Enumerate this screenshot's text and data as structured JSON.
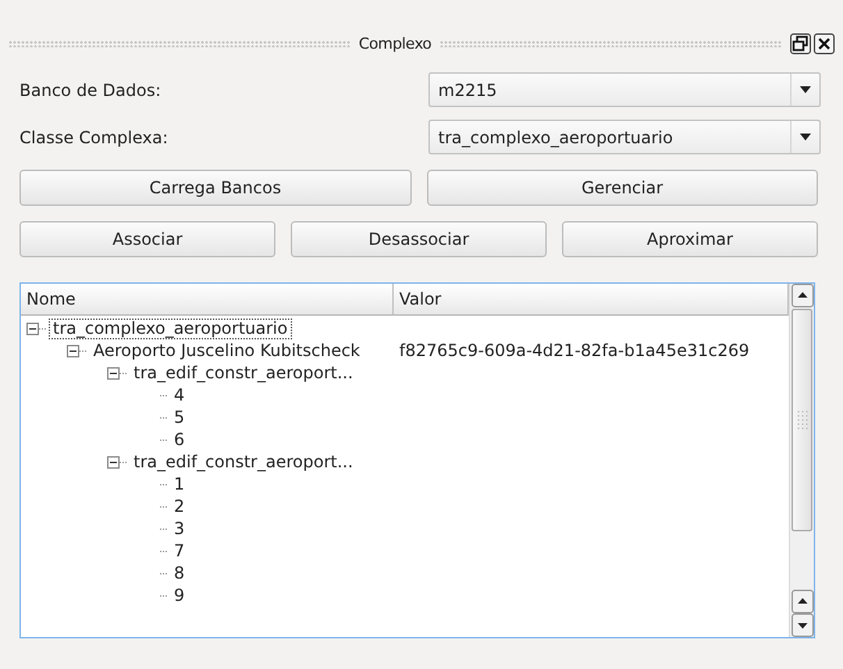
{
  "window": {
    "title": "Complexo"
  },
  "fields": [
    {
      "label": "Banco de Dados:",
      "value": "m2215"
    },
    {
      "label": "Classe Complexa:",
      "value": "tra_complexo_aeroportuario"
    }
  ],
  "button_rows": [
    [
      "Carrega Bancos",
      "Gerenciar"
    ],
    [
      "Associar",
      "Desassociar",
      "Aproximar"
    ]
  ],
  "tree": {
    "columns": [
      "Nome",
      "Valor"
    ],
    "rows": [
      {
        "name": "tra_complexo_aeroportuario",
        "selected": true,
        "expanded": true,
        "children": [
          {
            "name": "Aeroporto Juscelino Kubitscheck",
            "value": "f82765c9-609a-4d21-82fa-b1a45e31c269",
            "selected": false,
            "expanded": true,
            "children": [
              {
                "name": "tra_edif_constr_aeroport...",
                "selected": false,
                "expanded": true,
                "children": [
                  {
                    "name": "4",
                    "selected": false
                  },
                  {
                    "name": "5",
                    "selected": false
                  },
                  {
                    "name": "6",
                    "selected": false
                  }
                ]
              },
              {
                "name": "tra_edif_constr_aeroport...",
                "selected": false,
                "expanded": true,
                "children": [
                  {
                    "name": "1",
                    "selected": false
                  },
                  {
                    "name": "2",
                    "selected": false
                  },
                  {
                    "name": "3",
                    "selected": false
                  },
                  {
                    "name": "7",
                    "selected": false
                  },
                  {
                    "name": "8",
                    "selected": false
                  },
                  {
                    "name": "9",
                    "selected": false
                  }
                ]
              }
            ]
          }
        ]
      }
    ]
  }
}
